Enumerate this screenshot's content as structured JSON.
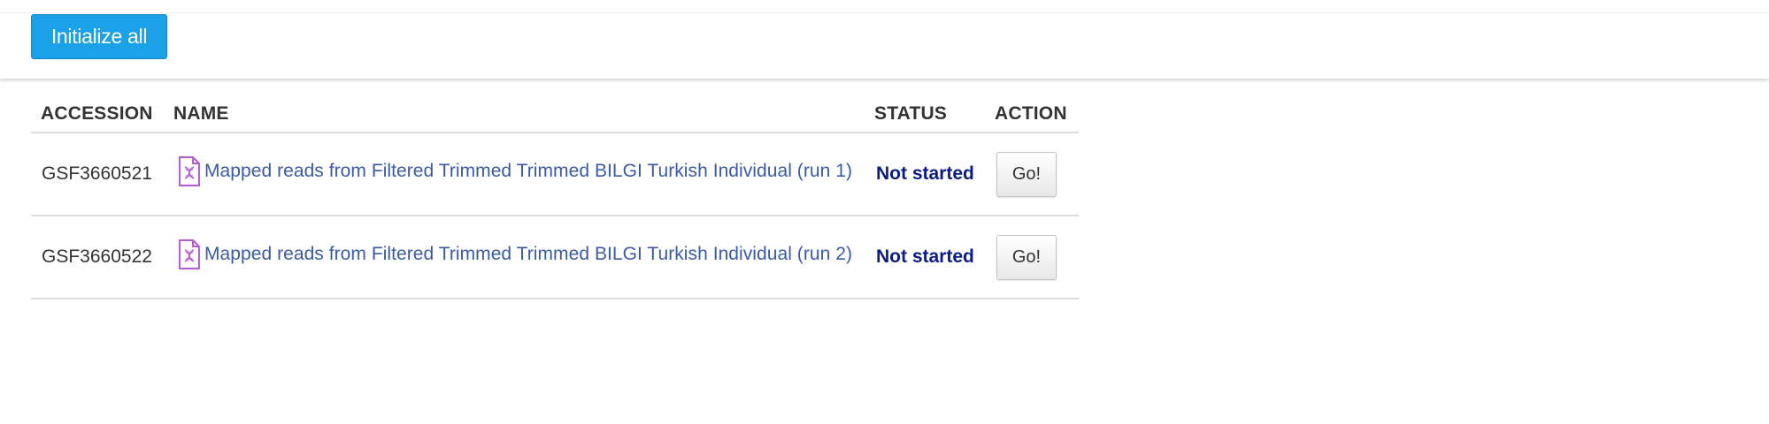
{
  "toolbar": {
    "initialize_all_label": "Initialize all",
    "accent_color": "#1ba1e8"
  },
  "table": {
    "headers": {
      "accession": "ACCESSION",
      "name": "NAME",
      "status": "STATUS",
      "action": "ACTION"
    },
    "rows": [
      {
        "accession": "GSF3660521",
        "icon": "dna-file-icon",
        "name": "Mapped reads from Filtered Trimmed Trimmed BILGI Turkish Individual (run 1)",
        "status": "Not started",
        "action_label": "Go!"
      },
      {
        "accession": "GSF3660522",
        "icon": "dna-file-icon",
        "name": "Mapped reads from Filtered Trimmed Trimmed BILGI Turkish Individual (run 2)",
        "status": "Not started",
        "action_label": "Go!"
      }
    ],
    "status_color": "#0b1b87",
    "link_color": "#3a5aa8"
  }
}
